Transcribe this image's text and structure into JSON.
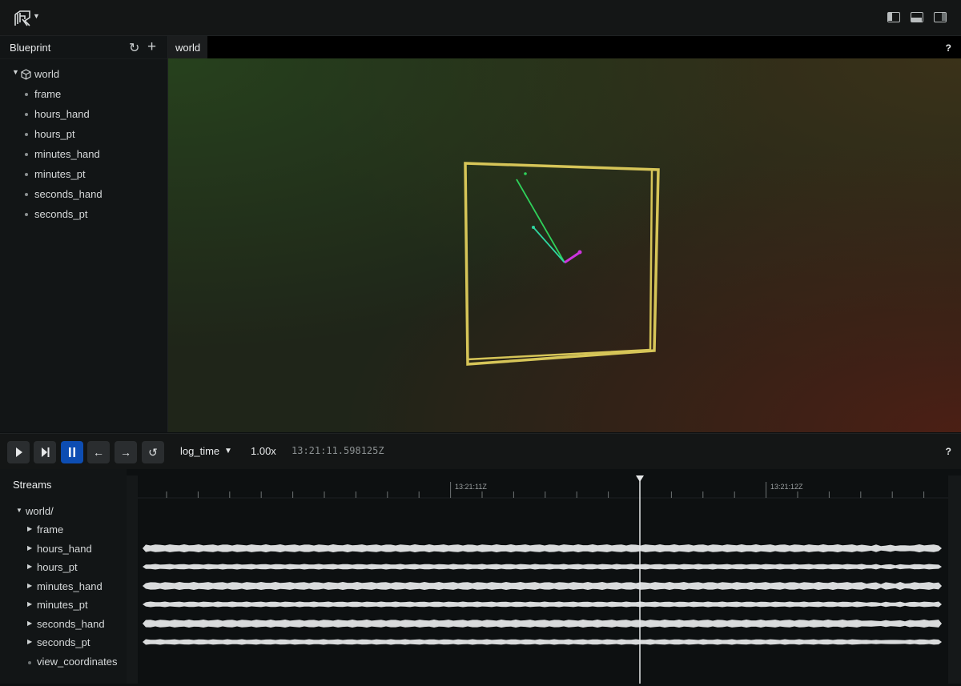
{
  "left_panel": {
    "title": "Blueprint",
    "root": "world",
    "items": [
      "frame",
      "hours_hand",
      "hours_pt",
      "minutes_hand",
      "minutes_pt",
      "seconds_hand",
      "seconds_pt"
    ]
  },
  "view": {
    "tab_title": "world",
    "help": "?"
  },
  "controls": {
    "timeline_name": "log_time",
    "speed": "1.00x",
    "time": "13:21:11.598125Z",
    "help": "?",
    "playing": "paused"
  },
  "streams": {
    "title": "Streams",
    "root": "world/",
    "items": [
      "frame",
      "hours_hand",
      "hours_pt",
      "minutes_hand",
      "minutes_pt",
      "seconds_hand",
      "seconds_pt"
    ],
    "leaf": "view_coordinates"
  },
  "timeline": {
    "tick_labels": [
      "13:21:11Z",
      "13:21:12Z"
    ]
  },
  "colors": {
    "accent": "#0d4db2",
    "frame": "#d6c558",
    "hand_green": "#2fd15a",
    "hand_magenta": "#cc33dd"
  }
}
